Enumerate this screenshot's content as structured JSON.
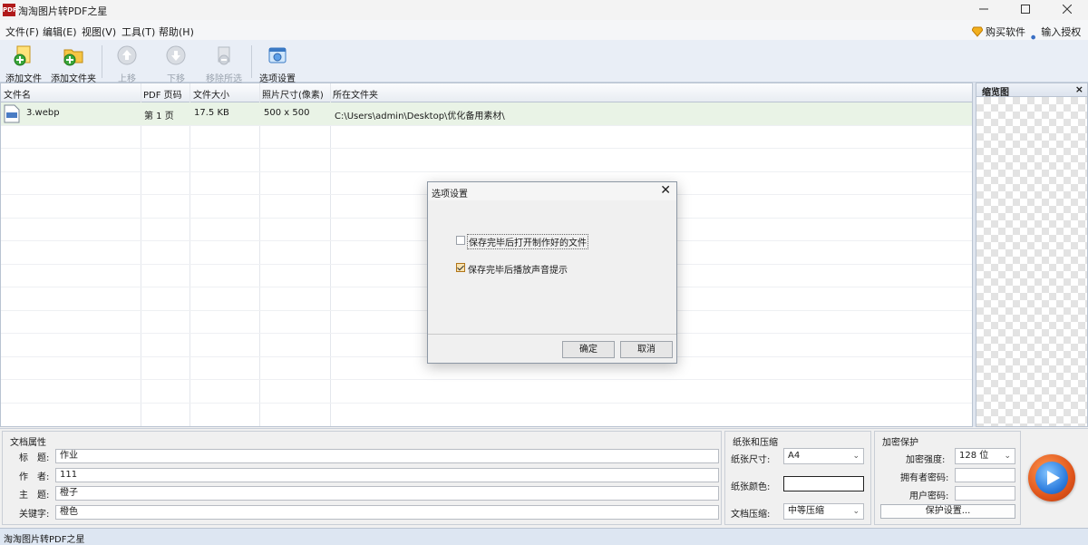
{
  "window": {
    "title": "淘淘图片转PDF之星",
    "app_icon_text": "PDF"
  },
  "menu": {
    "items": [
      "文件(F)",
      "编辑(E)",
      "视图(V)",
      "工具(T)",
      "帮助(H)"
    ],
    "buy": "购买软件",
    "register": "输入授权码"
  },
  "toolbar": {
    "add_file": "添加文件",
    "add_folder": "添加文件夹",
    "move_up": "上移",
    "move_down": "下移",
    "remove_selected": "移除所选",
    "options": "选项设置"
  },
  "table": {
    "columns": [
      "文件名",
      "PDF 页码",
      "文件大小",
      "照片尺寸(像素)",
      "所在文件夹"
    ],
    "rows": [
      {
        "name": "3.webp",
        "page": "第 1 页",
        "size": "17.5 KB",
        "dims": "500 x 500",
        "folder": "C:\\Users\\admin\\Desktop\\优化备用素材\\"
      }
    ]
  },
  "preview": {
    "title": "缩览图"
  },
  "doc_props": {
    "title": "文档属性",
    "title_label": "标　题:",
    "title_value": "作业",
    "author_label": "作　者:",
    "author_value": "111",
    "subject_label": "主　题:",
    "subject_value": "橙子",
    "keywords_label": "关键字:",
    "keywords_value": "橙色"
  },
  "paper": {
    "title": "纸张和压缩",
    "size_label": "纸张尺寸:",
    "size_value": "A4",
    "color_label": "纸张颜色:",
    "compress_label": "文档压缩:",
    "compress_value": "中等压缩"
  },
  "security": {
    "title": "加密保护",
    "strength_label": "加密强度:",
    "strength_value": "128 位",
    "owner_label": "拥有者密码:",
    "user_label": "用户密码:",
    "settings_button": "保护设置..."
  },
  "status": {
    "text": "淘淘图片转PDF之星"
  },
  "dialog": {
    "title": "选项设置",
    "option1": "保存完毕后打开制作好的文件",
    "option1_checked": false,
    "option2": "保存完毕后播放声音提示",
    "option2_checked": true,
    "ok": "确定",
    "cancel": "取消"
  },
  "icons": {
    "close": "close-icon",
    "minimize": "minimize-icon",
    "maximize": "maximize-icon"
  }
}
